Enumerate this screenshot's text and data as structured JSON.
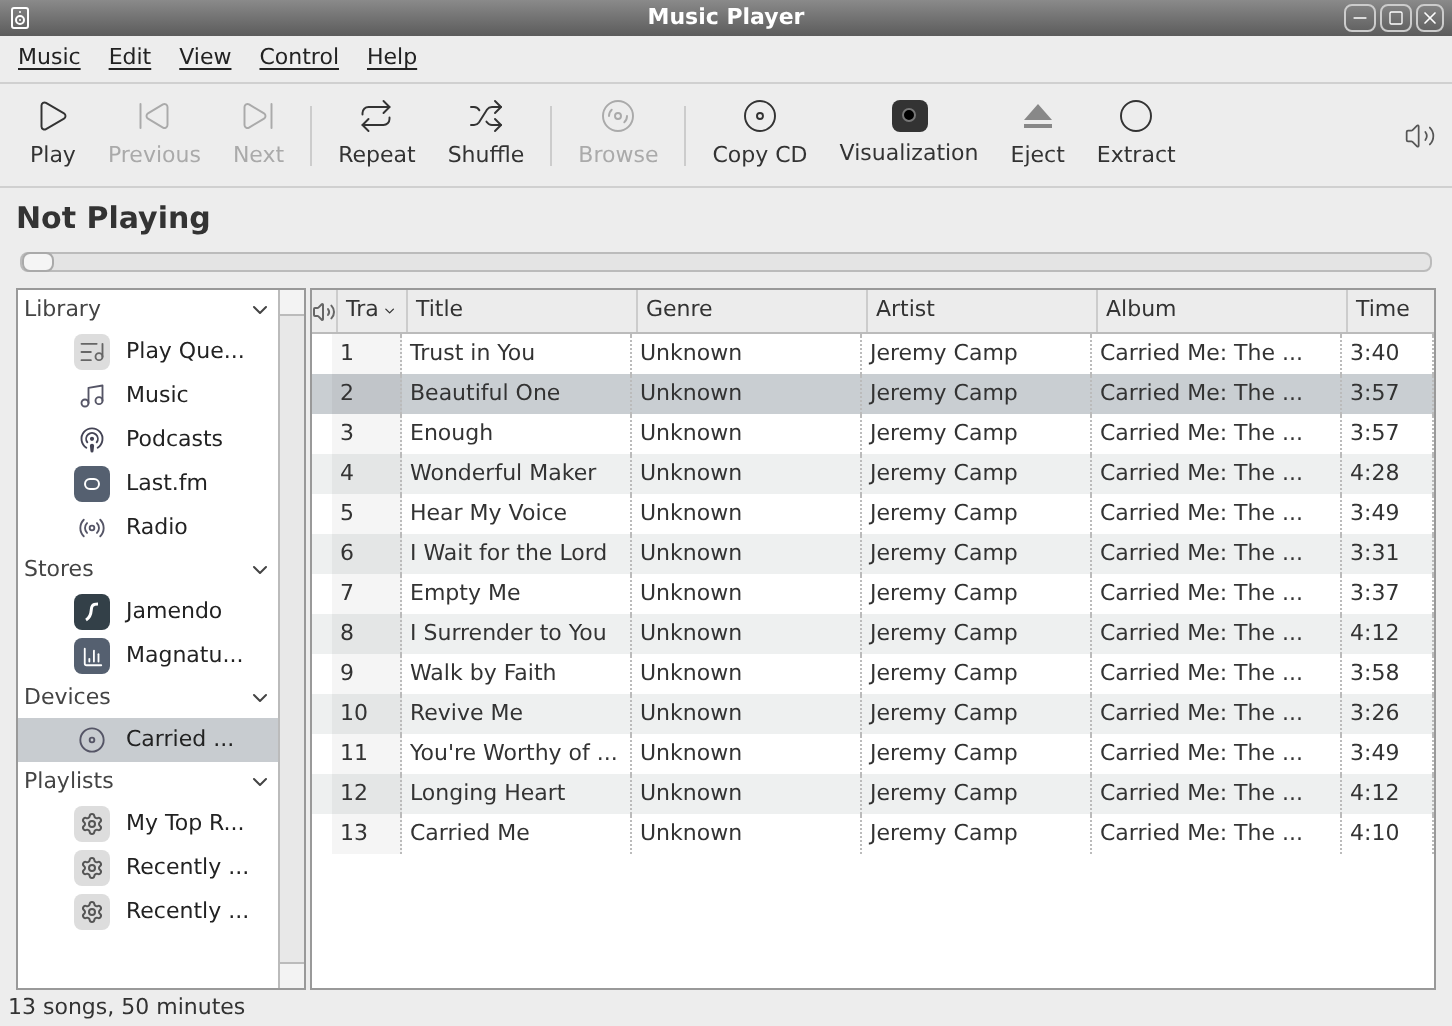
{
  "window": {
    "title": "Music Player"
  },
  "menu": [
    "Music",
    "Edit",
    "View",
    "Control",
    "Help"
  ],
  "toolbar": [
    {
      "kind": "play",
      "label": "Play",
      "disabled": false
    },
    {
      "kind": "previous",
      "label": "Previous",
      "disabled": true
    },
    {
      "kind": "next",
      "label": "Next",
      "disabled": true
    },
    {
      "kind": "separator"
    },
    {
      "kind": "repeat",
      "label": "Repeat",
      "disabled": false
    },
    {
      "kind": "shuffle",
      "label": "Shuffle",
      "disabled": false
    },
    {
      "kind": "separator"
    },
    {
      "kind": "browse",
      "label": "Browse",
      "disabled": true
    },
    {
      "kind": "separator"
    },
    {
      "kind": "copy",
      "label": "Copy CD",
      "disabled": false
    },
    {
      "kind": "visualization",
      "label": "Visualization",
      "disabled": false
    },
    {
      "kind": "eject",
      "label": "Eject",
      "disabled": false
    },
    {
      "kind": "extract",
      "label": "Extract",
      "disabled": false
    }
  ],
  "now_playing": "Not Playing",
  "position_slider": {
    "level": 0
  },
  "sidebar": [
    {
      "label": "Library",
      "expanded": true,
      "children": [
        {
          "kind": "queue",
          "label": "Play Que...",
          "selected": false
        },
        {
          "kind": "music",
          "label": "Music",
          "selected": false
        },
        {
          "kind": "podcast",
          "label": "Podcasts",
          "selected": false
        },
        {
          "kind": "lastfm",
          "label": "Last.fm",
          "selected": false
        },
        {
          "kind": "radio",
          "label": "Radio",
          "selected": false
        }
      ]
    },
    {
      "label": "Stores",
      "expanded": true,
      "children": [
        {
          "kind": "jamendo",
          "label": "Jamendo",
          "selected": false
        },
        {
          "kind": "magnatune",
          "label": "Magnatu...",
          "selected": false
        }
      ]
    },
    {
      "label": "Devices",
      "expanded": true,
      "children": [
        {
          "kind": "cd",
          "label": "Carried ...",
          "selected": true
        }
      ]
    },
    {
      "label": "Playlists",
      "expanded": true,
      "children": [
        {
          "kind": "playlist",
          "label": "My Top R...",
          "selected": false
        },
        {
          "kind": "playlist",
          "label": "Recently ...",
          "selected": false
        },
        {
          "kind": "playlist",
          "label": "Recently ...",
          "selected": false
        }
      ]
    }
  ],
  "table": {
    "columns": [
      "Tra",
      "Title",
      "Genre",
      "Artist",
      "Album",
      "Time"
    ],
    "rows": [
      {
        "cells": [
          "1",
          "Trust in You",
          "Unknown",
          "Jeremy Camp",
          "Carried Me: The ...",
          "3:40"
        ],
        "selected": false
      },
      {
        "cells": [
          "2",
          "Beautiful One",
          "Unknown",
          "Jeremy Camp",
          "Carried Me: The ...",
          "3:57"
        ],
        "selected": true
      },
      {
        "cells": [
          "3",
          "Enough",
          "Unknown",
          "Jeremy Camp",
          "Carried Me: The ...",
          "3:57"
        ],
        "selected": false
      },
      {
        "cells": [
          "4",
          "Wonderful Maker",
          "Unknown",
          "Jeremy Camp",
          "Carried Me: The ...",
          "4:28"
        ],
        "selected": false
      },
      {
        "cells": [
          "5",
          "Hear My Voice",
          "Unknown",
          "Jeremy Camp",
          "Carried Me: The ...",
          "3:49"
        ],
        "selected": false
      },
      {
        "cells": [
          "6",
          "I Wait for the Lord",
          "Unknown",
          "Jeremy Camp",
          "Carried Me: The ...",
          "3:31"
        ],
        "selected": false
      },
      {
        "cells": [
          "7",
          "Empty Me",
          "Unknown",
          "Jeremy Camp",
          "Carried Me: The ...",
          "3:37"
        ],
        "selected": false
      },
      {
        "cells": [
          "8",
          "I Surrender to You",
          "Unknown",
          "Jeremy Camp",
          "Carried Me: The ...",
          "4:12"
        ],
        "selected": false
      },
      {
        "cells": [
          "9",
          "Walk by Faith",
          "Unknown",
          "Jeremy Camp",
          "Carried Me: The ...",
          "3:58"
        ],
        "selected": false
      },
      {
        "cells": [
          "10",
          "Revive Me",
          "Unknown",
          "Jeremy Camp",
          "Carried Me: The ...",
          "3:26"
        ],
        "selected": false
      },
      {
        "cells": [
          "11",
          "You're Worthy of ...",
          "Unknown",
          "Jeremy Camp",
          "Carried Me: The ...",
          "3:49"
        ],
        "selected": false
      },
      {
        "cells": [
          "12",
          "Longing Heart",
          "Unknown",
          "Jeremy Camp",
          "Carried Me: The ...",
          "4:12"
        ],
        "selected": false
      },
      {
        "cells": [
          "13",
          "Carried Me",
          "Unknown",
          "Jeremy Camp",
          "Carried Me: The ...",
          "4:10"
        ],
        "selected": false
      }
    ]
  },
  "status_bar": "13 songs, 50 minutes"
}
